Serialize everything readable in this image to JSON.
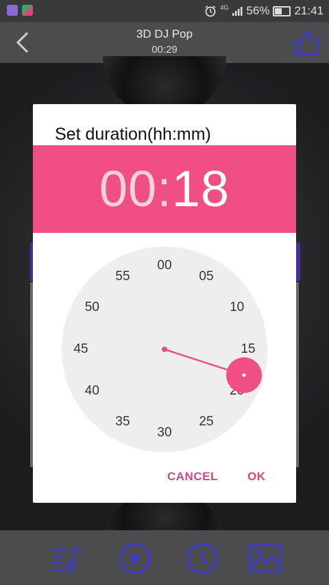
{
  "status_bar": {
    "network": "4G",
    "battery": "56%",
    "time": "21:41"
  },
  "header": {
    "title": "3D DJ Pop",
    "duration": "00:29"
  },
  "dialog": {
    "title": "Set duration(hh:mm)",
    "hours": "00",
    "separator": ":",
    "minutes": "18",
    "selected_minute": 18,
    "dial_labels": [
      "00",
      "05",
      "10",
      "15",
      "20",
      "25",
      "30",
      "35",
      "40",
      "45",
      "50",
      "55"
    ],
    "cancel_label": "CANCEL",
    "ok_label": "OK",
    "accent_color": "#f04f83"
  },
  "bottom_bar": {
    "icons": [
      "playlist-icon",
      "play-icon",
      "clock-icon",
      "image-icon"
    ]
  }
}
